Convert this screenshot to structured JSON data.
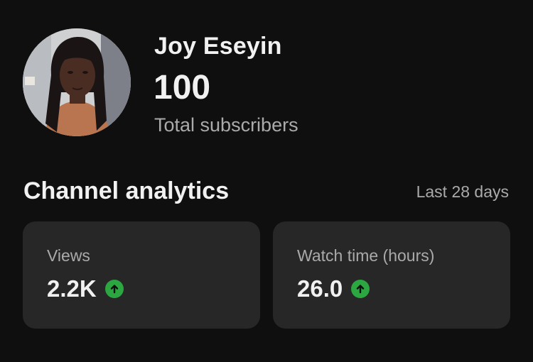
{
  "profile": {
    "channel_name": "Joy Eseyin",
    "subscriber_count": "100",
    "subscriber_label": "Total subscribers"
  },
  "analytics": {
    "title": "Channel analytics",
    "period": "Last 28 days",
    "cards": [
      {
        "label": "Views",
        "value": "2.2K",
        "trend": "up",
        "trend_icon": "arrow-up-circle-icon"
      },
      {
        "label": "Watch time (hours)",
        "value": "26.0",
        "trend": "up",
        "trend_icon": "arrow-up-circle-icon"
      }
    ]
  },
  "colors": {
    "background": "#0f0f0f",
    "card": "#272727",
    "primary_text": "#f1f1f1",
    "secondary_text": "#aaaaaa",
    "trend_up": "#2ba640"
  }
}
